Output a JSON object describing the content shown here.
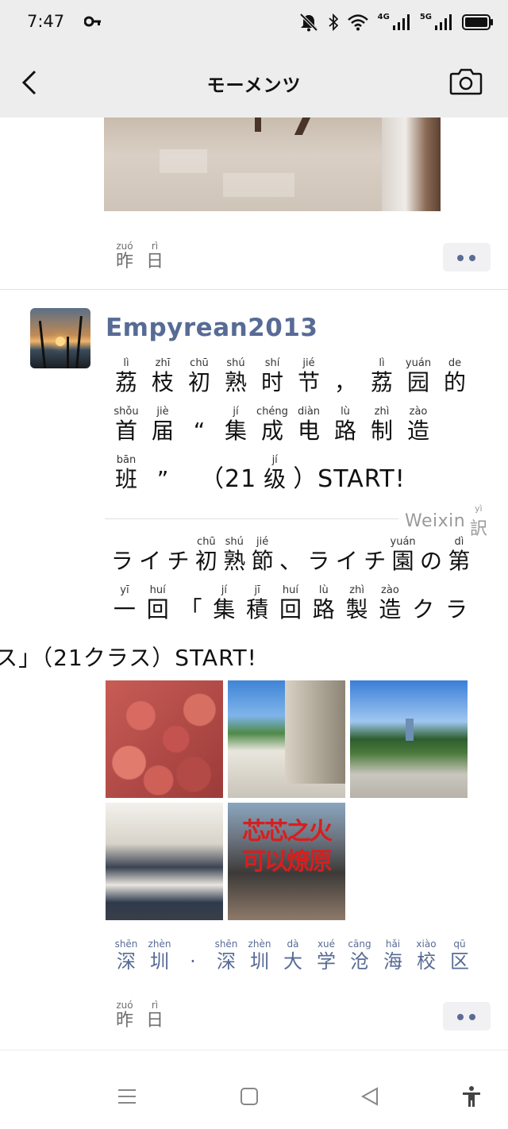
{
  "status": {
    "time": "7:47",
    "network_label": "4G",
    "network_label2": "5G",
    "icons": [
      "key-icon",
      "mute-icon",
      "bluetooth-icon",
      "wifi-icon",
      "signal-icon",
      "signal-icon",
      "battery-icon"
    ]
  },
  "header": {
    "title": "モーメンツ",
    "back_icon": "chevron-left-icon",
    "camera_icon": "camera-icon"
  },
  "prev_post": {
    "time": [
      {
        "py": "zuó",
        "ch": "昨"
      },
      {
        "py": "rì",
        "ch": "日"
      }
    ]
  },
  "post": {
    "author": "Empyrean2013",
    "text_zh_lines": [
      [
        {
          "py": "lì",
          "ch": "荔"
        },
        {
          "py": "zhī",
          "ch": "枝"
        },
        {
          "py": "chū",
          "ch": "初"
        },
        {
          "py": "shú",
          "ch": "熟"
        },
        {
          "py": "shí",
          "ch": "时"
        },
        {
          "py": "jié",
          "ch": "节"
        },
        {
          "py": "",
          "ch": "，"
        },
        {
          "py": "lì",
          "ch": "荔"
        },
        {
          "py": "yuán",
          "ch": "园"
        },
        {
          "py": "de",
          "ch": "的"
        }
      ],
      [
        {
          "py": "shǒu",
          "ch": "首"
        },
        {
          "py": "jiè",
          "ch": "届"
        },
        {
          "py": "",
          "ch": "“"
        },
        {
          "py": "jí",
          "ch": "集"
        },
        {
          "py": "chéng",
          "ch": "成"
        },
        {
          "py": "diàn",
          "ch": "电"
        },
        {
          "py": "lù",
          "ch": "路"
        },
        {
          "py": "zhì",
          "ch": "制"
        },
        {
          "py": "zào",
          "ch": "造"
        }
      ]
    ],
    "text_zh_line3": {
      "pre": [
        {
          "py": "bān",
          "ch": "班"
        },
        {
          "py": "",
          "ch": "”"
        }
      ],
      "mid_open": "（21",
      "ji": {
        "py": "jí",
        "ch": "级"
      },
      "tail": "）START!"
    },
    "translate_badge": {
      "label": "Weixin",
      "yi": "訳",
      "yi_py": "yì"
    },
    "text_jp_lines": [
      [
        {
          "py": "",
          "ch": "ラ"
        },
        {
          "py": "",
          "ch": "イ"
        },
        {
          "py": "",
          "ch": "チ"
        },
        {
          "py": "chū",
          "ch": "初"
        },
        {
          "py": "shú",
          "ch": "熟"
        },
        {
          "py": "jié",
          "ch": "節"
        },
        {
          "py": "",
          "ch": "、"
        },
        {
          "py": "",
          "ch": "ラ"
        },
        {
          "py": "",
          "ch": "イ"
        },
        {
          "py": "",
          "ch": "チ"
        },
        {
          "py": "yuán",
          "ch": "園"
        },
        {
          "py": "",
          "ch": "の"
        },
        {
          "py": "dì",
          "ch": "第"
        }
      ],
      [
        {
          "py": "yī",
          "ch": "一"
        },
        {
          "py": "huí",
          "ch": "回"
        },
        {
          "py": "",
          "ch": "「"
        },
        {
          "py": "jí",
          "ch": "集"
        },
        {
          "py": "jī",
          "ch": "積"
        },
        {
          "py": "huí",
          "ch": "回"
        },
        {
          "py": "lù",
          "ch": "路"
        },
        {
          "py": "zhì",
          "ch": "製"
        },
        {
          "py": "zào",
          "ch": "造"
        },
        {
          "py": "",
          "ch": "ク"
        },
        {
          "py": "",
          "ch": "ラ"
        }
      ]
    ],
    "text_jp_line3": "ス」（21クラス）START!",
    "photos": [
      {
        "name": "lychee-photo"
      },
      {
        "name": "campus-building-photo"
      },
      {
        "name": "campus-plaza-photo"
      },
      {
        "name": "group-photo"
      },
      {
        "name": "calligraphy-poster-photo",
        "caption": "芯芯之火 可以燎原"
      }
    ],
    "location": [
      {
        "py": "shēn",
        "ch": "深"
      },
      {
        "py": "zhèn",
        "ch": "圳"
      },
      {
        "py": "",
        "ch": "·"
      },
      {
        "py": "shēn",
        "ch": "深"
      },
      {
        "py": "zhèn",
        "ch": "圳"
      },
      {
        "py": "dà",
        "ch": "大"
      },
      {
        "py": "xué",
        "ch": "学"
      },
      {
        "py": "cāng",
        "ch": "沧"
      },
      {
        "py": "hǎi",
        "ch": "海"
      },
      {
        "py": "xiào",
        "ch": "校"
      },
      {
        "py": "qū",
        "ch": "区"
      }
    ],
    "time": [
      {
        "py": "zuó",
        "ch": "昨"
      },
      {
        "py": "rì",
        "ch": "日"
      }
    ]
  },
  "colors": {
    "link": "#576b95",
    "header_bg": "#ededed"
  }
}
